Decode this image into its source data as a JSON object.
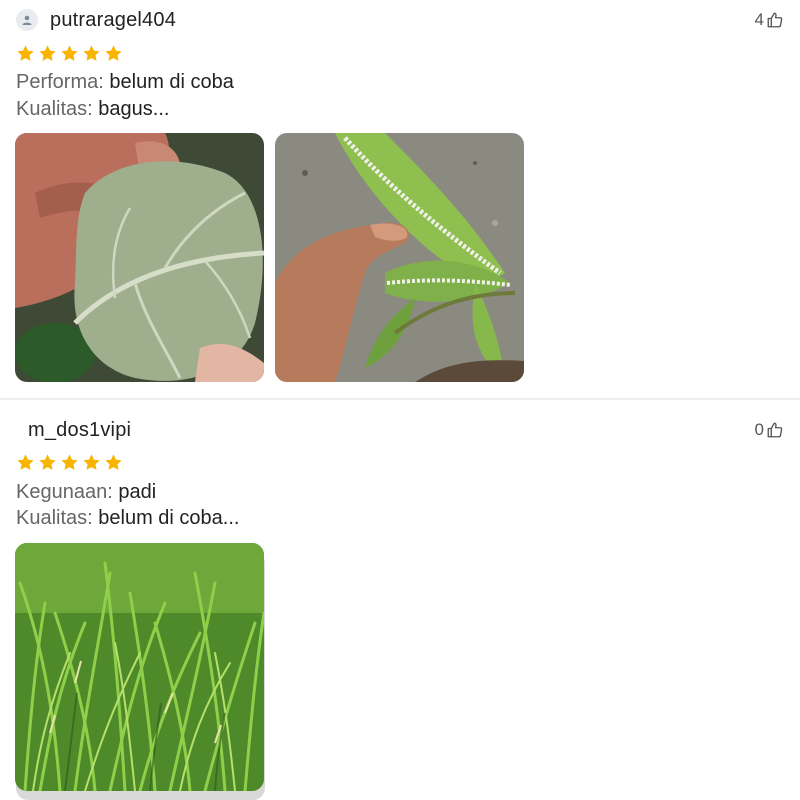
{
  "reviews": [
    {
      "username": "putraragel404",
      "likes": "4",
      "rating": 5,
      "lines": [
        {
          "key": "Performa:",
          "value": "belum di coba"
        },
        {
          "key": "Kualitas:",
          "value": "bagus..."
        }
      ],
      "photos": [
        "leaf-underside-photo",
        "mango-leaves-photo"
      ]
    },
    {
      "username": "m_dos1vipi",
      "likes": "0",
      "rating": 5,
      "lines": [
        {
          "key": "Kegunaan:",
          "value": "padi"
        },
        {
          "key": "Kualitas:",
          "value": "belum di coba..."
        }
      ],
      "photos": [
        "rice-field-photo"
      ]
    }
  ],
  "colors": {
    "star": "#f7b500",
    "divider": "#eeeeee",
    "label": "#666666",
    "text": "#222222"
  },
  "icons": {
    "avatar_default": "person-icon",
    "like": "thumbs-up-icon",
    "star": "star-icon"
  }
}
